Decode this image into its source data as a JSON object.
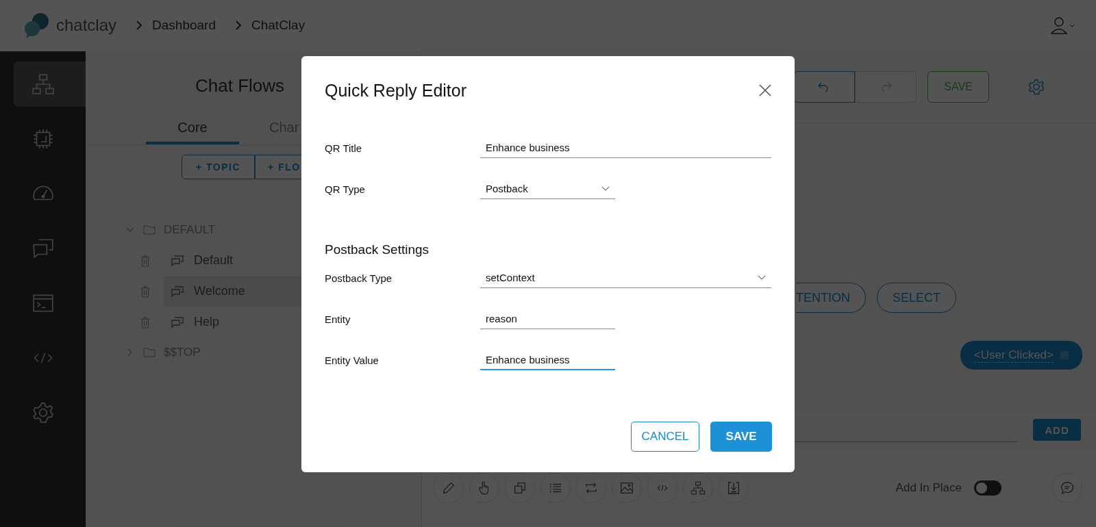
{
  "header": {
    "logo_text": "chatclay",
    "breadcrumbs": [
      "Dashboard",
      "ChatClay"
    ]
  },
  "sidebar": {
    "items": [
      {
        "kind": "flows",
        "selected": true
      },
      {
        "kind": "chip",
        "selected": false
      },
      {
        "kind": "gauge",
        "selected": false
      },
      {
        "kind": "chat",
        "selected": false
      },
      {
        "kind": "terminal",
        "selected": false
      },
      {
        "kind": "code",
        "selected": false
      },
      {
        "kind": "settings",
        "selected": false
      }
    ]
  },
  "flows_panel": {
    "title": "Chat Flows",
    "tabs": [
      {
        "label": "Core",
        "selected": true
      },
      {
        "label": "Char",
        "selected": false
      }
    ],
    "buttons": [
      "+ TOPIC",
      "+ FLO"
    ],
    "tree": [
      {
        "label": "DEFAULT",
        "expanded": true,
        "children": [
          {
            "label": "Default",
            "selected": false
          },
          {
            "label": "Welcome",
            "selected": true
          },
          {
            "label": "Help",
            "selected": false
          }
        ]
      },
      {
        "label": "$$TOP",
        "expanded": false
      }
    ]
  },
  "editor": {
    "save_label": "SAVE",
    "chips": [
      "TENTION",
      "SELECT"
    ],
    "bubble": "<User Clicked>",
    "add_label": "ADD",
    "tools": [
      {
        "kind": "pencil"
      },
      {
        "kind": "hand"
      },
      {
        "kind": "copy"
      },
      {
        "kind": "list"
      },
      {
        "kind": "swap"
      },
      {
        "kind": "image"
      },
      {
        "kind": "code"
      },
      {
        "kind": "flows"
      },
      {
        "kind": "download"
      }
    ],
    "add_in_place": {
      "label": "Add In Place",
      "on": false
    }
  },
  "dialog": {
    "title": "Quick Reply Editor",
    "rows": [
      {
        "kind": "text",
        "label": "QR Title",
        "wide": true,
        "value": "Enhance business",
        "focused": false
      },
      {
        "kind": "select",
        "label": "QR Type",
        "wide": false,
        "value": "Postback",
        "focused": false
      },
      {
        "kind": "heading",
        "label": "Postback Settings"
      },
      {
        "kind": "select",
        "label": "Postback Type",
        "wide": true,
        "value": "setContext",
        "focused": false
      },
      {
        "kind": "text",
        "label": "Entity",
        "wide": false,
        "value": "reason",
        "focused": false
      },
      {
        "kind": "text",
        "label": "Entity Value",
        "wide": false,
        "value": "Enhance business",
        "focused": true
      }
    ],
    "buttons": [
      {
        "label": "CANCEL",
        "kind": "secondary"
      },
      {
        "label": "SAVE",
        "kind": "primary"
      }
    ]
  }
}
